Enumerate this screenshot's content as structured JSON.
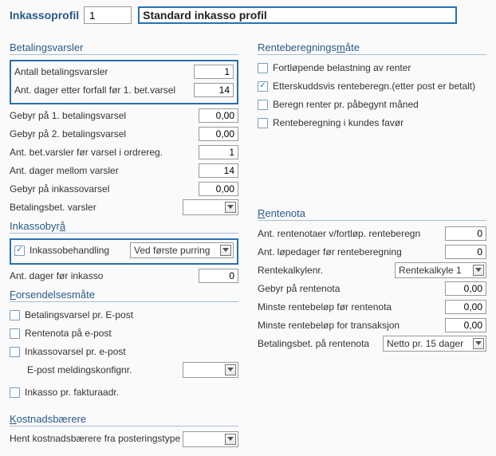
{
  "header": {
    "label": "Inkassoprofil",
    "nr": "1",
    "name": "Standard inkasso profil"
  },
  "left": {
    "betalingsvarsler": {
      "title": "Betalingsvarsler",
      "antall_label": "Antall betalingsvarsler",
      "antall_value": "1",
      "dager_forfall_label": "Ant. dager etter forfall før 1. bet.varsel",
      "dager_forfall_value": "14",
      "gebyr1_label": "Gebyr på 1. betalingsvarsel",
      "gebyr1_value": "0,00",
      "gebyr2_label": "Gebyr på 2. betalingsvarsel",
      "gebyr2_value": "0,00",
      "ant_bet_ordrereg_label": "Ant. bet.varsler før varsel i ordrereg.",
      "ant_bet_ordrereg_value": "1",
      "ant_mellom_label": "Ant. dager mellom varsler",
      "ant_mellom_value": "14",
      "gebyr_inkasso_label": "Gebyr på inkassovarsel",
      "gebyr_inkasso_value": "0,00",
      "betalingsbet_label": "Betalingsbet. varsler",
      "betalingsbet_value": ""
    },
    "inkassobyra": {
      "title": "Inkassobyrå",
      "inkassobehandling_label": "Inkassobehandling",
      "inkassobehandling_value": "Ved første purring",
      "ant_dager_label": "Ant. dager før inkasso",
      "ant_dager_value": "0"
    },
    "forsendelse": {
      "title": "Forsendelsesmåte",
      "bet_epost_label": "Betalingsvarsel pr. E-post",
      "rentenota_epost_label": "Rentenota på e-post",
      "inkasso_epost_label": "Inkassovarsel pr. e-post",
      "epost_config_label": "E-post meldingskonfignr.",
      "epost_config_value": "",
      "inkasso_fakturaadr_label": "Inkasso pr. fakturaadr."
    },
    "kostnad": {
      "title": "Kostnadsbærere",
      "hent_label": "Hent kostnadsbærere\nfra posteringstype",
      "hent_value": ""
    }
  },
  "right": {
    "renteberegn": {
      "title": "Renteberegningsmåte",
      "fortlopende_label": "Fortløpende belastning av renter",
      "etterskudd_label": "Etterskuddsvis renteberegn.(etter post er betalt)",
      "pabegynt_label": "Beregn renter pr. påbegynt måned",
      "kundes_favor_label": "Renteberegning i kundes favør"
    },
    "rentenota": {
      "title": "Rentenota",
      "ant_rentenotaer_label": "Ant. rentenotaer v/fortløp. renteberegn",
      "ant_rentenotaer_value": "0",
      "ant_lopedager_label": "Ant. løpedager før renteberegning",
      "ant_lopedager_value": "0",
      "rentekalkylenr_label": "Rentekalkylenr.",
      "rentekalkylenr_value": "Rentekalkyle 1",
      "gebyr_label": "Gebyr på rentenota",
      "gebyr_value": "0,00",
      "minste_belop_label": "Minste rentebeløp før rentenota",
      "minste_belop_value": "0,00",
      "minste_trans_label": "Minste rentebeløp for transaksjon",
      "minste_trans_value": "0,00",
      "betalingsbet_label": "Betalingsbet. på rentenota",
      "betalingsbet_value": "Netto pr. 15 dager"
    }
  }
}
